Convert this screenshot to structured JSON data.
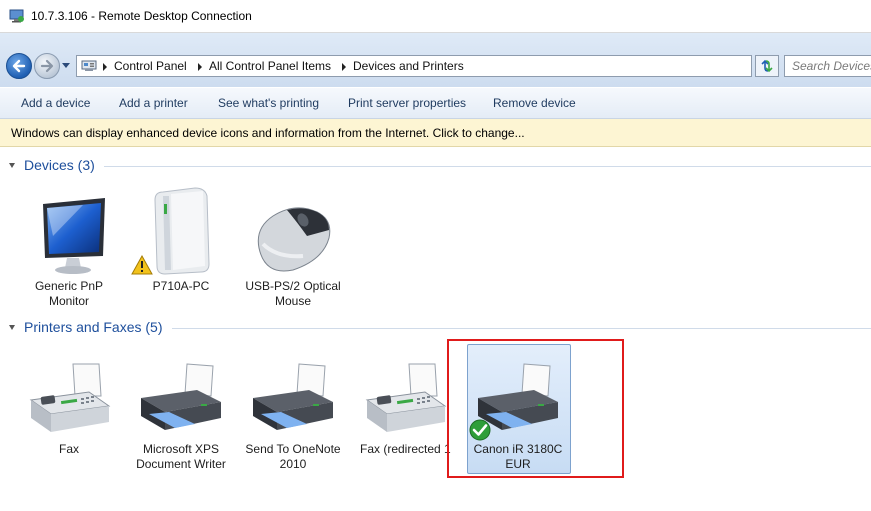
{
  "window": {
    "title": "10.7.3.106 - Remote Desktop Connection"
  },
  "address_bar": {
    "breadcrumbs": [
      "Control Panel",
      "All Control Panel Items",
      "Devices and Printers"
    ],
    "search_placeholder": "Search Devices"
  },
  "toolbar": {
    "commands": [
      "Add a device",
      "Add a printer",
      "See what's printing",
      "Print server properties",
      "Remove device"
    ]
  },
  "info_bar": {
    "text": "Windows can display enhanced device icons and information from the Internet. Click to change..."
  },
  "devices_group": {
    "title": "Devices (3)",
    "items": [
      {
        "label": "Generic PnP Monitor",
        "icon": "monitor-icon"
      },
      {
        "label": "P710A-PC",
        "icon": "computer-tower-icon",
        "status": "warning"
      },
      {
        "label": "USB-PS/2 Optical Mouse",
        "icon": "mouse-icon"
      }
    ]
  },
  "printers_group": {
    "title": "Printers and Faxes (5)",
    "items": [
      {
        "label": "Fax",
        "icon": "fax-icon"
      },
      {
        "label": "Microsoft XPS Document Writer",
        "icon": "printer-icon"
      },
      {
        "label": "Send To OneNote 2010",
        "icon": "printer-icon"
      },
      {
        "label": "Fax (redirected 1",
        "icon": "fax-icon"
      },
      {
        "label": "Canon iR 3180C EUR",
        "icon": "printer-icon",
        "status": "default",
        "selected": true
      }
    ]
  },
  "colors": {
    "accent": "#1e4f9c",
    "info_bar": "#fdf5d3",
    "highlight": "#e01b1b",
    "selection": "#c7dcf4"
  }
}
